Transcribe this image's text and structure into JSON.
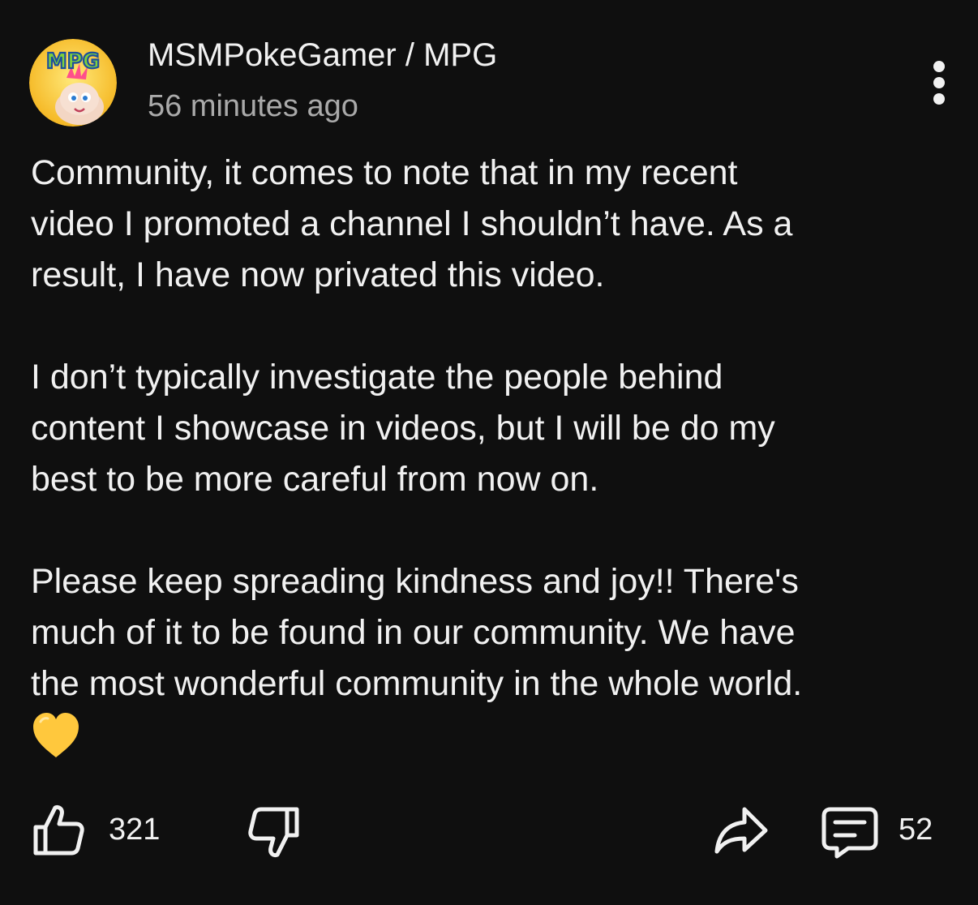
{
  "post": {
    "author": "MSMPokeGamer / MPG",
    "avatar_text": "MPG",
    "timestamp": "56 minutes ago",
    "paragraphs": [
      "Community, it comes to note that in my recent\nvideo I promoted a channel I shouldn’t have.  As a\nresult, I have now privated this video.",
      "I don’t typically investigate the people behind\ncontent I showcase in videos, but I will be do my\nbest to be more careful from now on.",
      "Please keep spreading kindness and joy!! There's\nmuch of it to be found in our community. We have\nthe most wonderful community in the whole world."
    ],
    "emoji": "yellow-heart"
  },
  "actions": {
    "like_count": "321",
    "comment_count": "52"
  },
  "icons": {
    "like": "thumbs-up-icon",
    "dislike": "thumbs-down-icon",
    "share": "share-icon",
    "comment": "comment-icon",
    "menu": "more-vertical-icon"
  },
  "colors": {
    "background": "#0f0f0f",
    "text": "#f1f1f1",
    "secondary_text": "#aaaaaa",
    "heart": "#ffc83d"
  }
}
